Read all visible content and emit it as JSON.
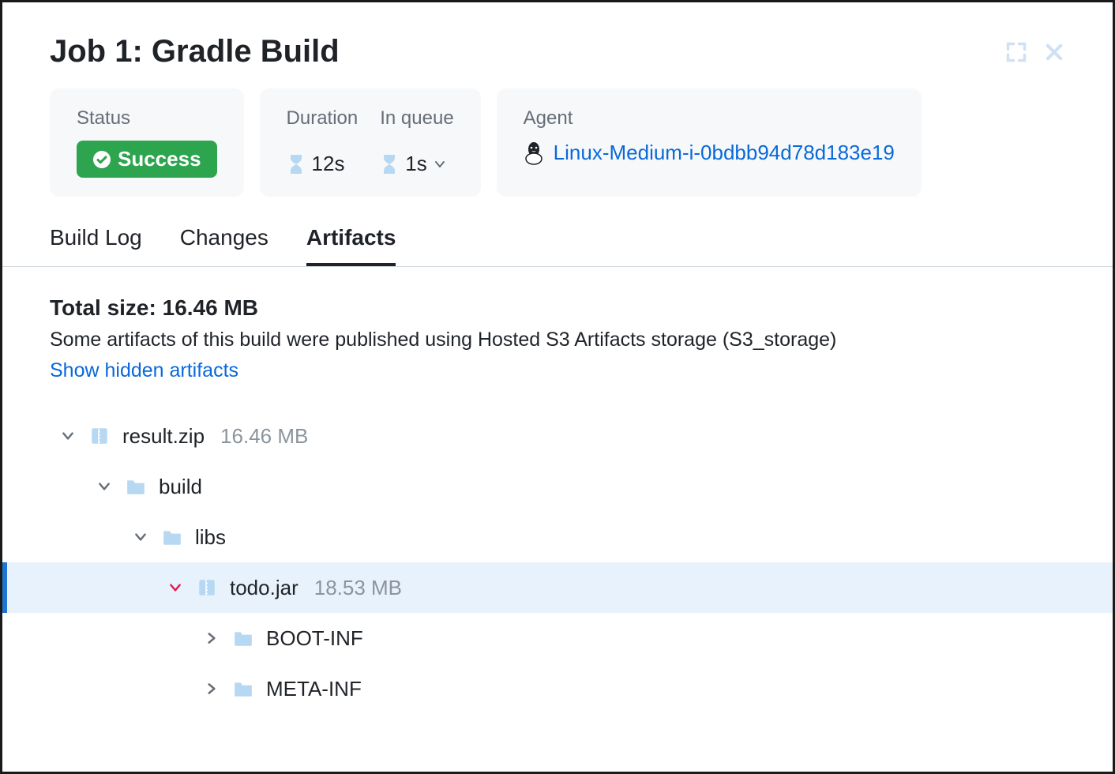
{
  "header": {
    "title": "Job 1: Gradle Build"
  },
  "cards": {
    "status": {
      "label": "Status",
      "value": "Success"
    },
    "duration": {
      "label": "Duration",
      "value": "12s"
    },
    "queue": {
      "label": "In queue",
      "value": "1s"
    },
    "agent": {
      "label": "Agent",
      "name": "Linux-Medium-i-0bdbb94d78d183e19"
    }
  },
  "tabs": {
    "buildlog": "Build Log",
    "changes": "Changes",
    "artifacts": "Artifacts"
  },
  "artifacts": {
    "total_label": "Total size: ",
    "total_value": "16.46 MB",
    "note": "Some artifacts of this build were published using Hosted S3 Artifacts storage (S3_storage)",
    "show_hidden": "Show hidden artifacts",
    "tree": [
      {
        "name": "result.zip",
        "size": "16.46 MB",
        "type": "archive",
        "expanded": true,
        "indent": 0
      },
      {
        "name": "build",
        "size": "",
        "type": "folder",
        "expanded": true,
        "indent": 1
      },
      {
        "name": "libs",
        "size": "",
        "type": "folder",
        "expanded": true,
        "indent": 2
      },
      {
        "name": "todo.jar",
        "size": "18.53 MB",
        "type": "archive",
        "expanded": true,
        "indent": 3,
        "selected": true
      },
      {
        "name": "BOOT-INF",
        "size": "",
        "type": "folder",
        "expanded": false,
        "indent": 4
      },
      {
        "name": "META-INF",
        "size": "",
        "type": "folder",
        "expanded": false,
        "indent": 4
      }
    ]
  }
}
